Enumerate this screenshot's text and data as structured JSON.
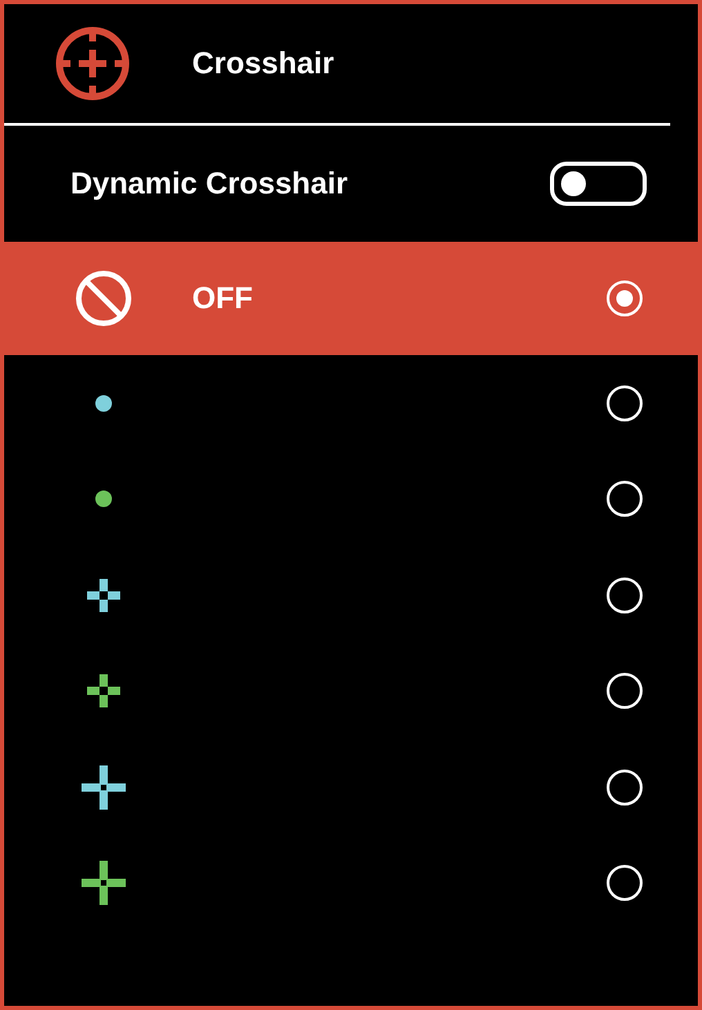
{
  "header": {
    "title": "Crosshair"
  },
  "dynamic_crosshair": {
    "label": "Dynamic Crosshair",
    "on": false
  },
  "options": [
    {
      "kind": "off",
      "label": "OFF",
      "selected": true
    },
    {
      "kind": "dot",
      "color": "#7fd0dc",
      "selected": false
    },
    {
      "kind": "dot",
      "color": "#6cc25a",
      "selected": false
    },
    {
      "kind": "small-cross",
      "color": "#7fd0dc",
      "selected": false
    },
    {
      "kind": "small-cross",
      "color": "#6cc25a",
      "selected": false
    },
    {
      "kind": "large-cross",
      "color": "#7fd0dc",
      "selected": false
    },
    {
      "kind": "large-cross",
      "color": "#6cc25a",
      "selected": false
    }
  ]
}
